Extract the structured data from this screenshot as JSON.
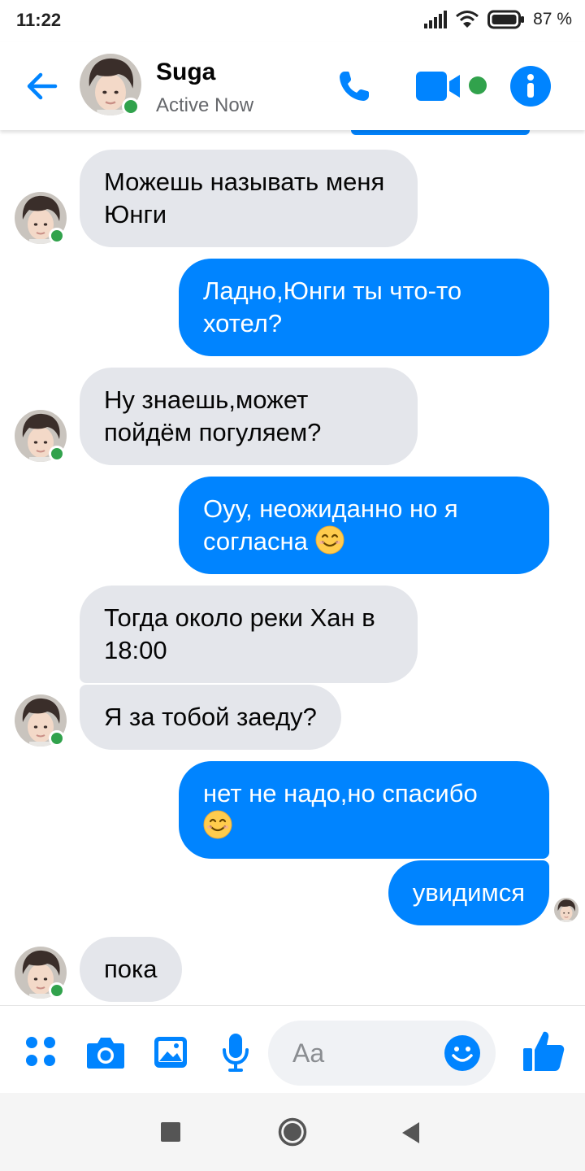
{
  "status_bar": {
    "time": "11:22",
    "battery": "87 %",
    "icons": [
      "signal-icon",
      "wifi-icon",
      "battery-icon"
    ]
  },
  "header": {
    "contact_name": "Suga",
    "contact_status": "Active Now",
    "icons": [
      "back-arrow-icon",
      "phone-icon",
      "video-camera-icon",
      "info-icon"
    ]
  },
  "messages": [
    {
      "from": "them",
      "text": "Можешь называть меня Юнги"
    },
    {
      "from": "me",
      "text": "Ладно,Юнги ты что-то хотел?"
    },
    {
      "from": "them",
      "text": "Ну знаешь,может пойдём погуляем?"
    },
    {
      "from": "me",
      "text": "Оуу, неожиданно но я согласна",
      "emoji": "smiling-face-emoji"
    },
    {
      "from": "them",
      "text": "Тогда около реки Хан в 18:00"
    },
    {
      "from": "them",
      "text": "Я за тобой заеду?"
    },
    {
      "from": "me",
      "text": "нет не надо,но спасибо",
      "emoji": "smiling-face-emoji"
    },
    {
      "from": "me",
      "text": "увидимся"
    },
    {
      "from": "them",
      "text": "пока"
    }
  ],
  "composer": {
    "placeholder": "Aa",
    "icons": [
      "apps-grid-icon",
      "camera-icon",
      "gallery-icon",
      "microphone-icon",
      "emoji-icon",
      "thumbs-up-icon"
    ]
  },
  "nav_bar": {
    "icons": [
      "recents-square-icon",
      "home-circle-icon",
      "back-triangle-icon"
    ]
  },
  "colors": {
    "accent": "#0084ff",
    "incoming_bubble": "#e4e6eb",
    "online": "#31a24c",
    "secondary_text": "#65676b"
  }
}
